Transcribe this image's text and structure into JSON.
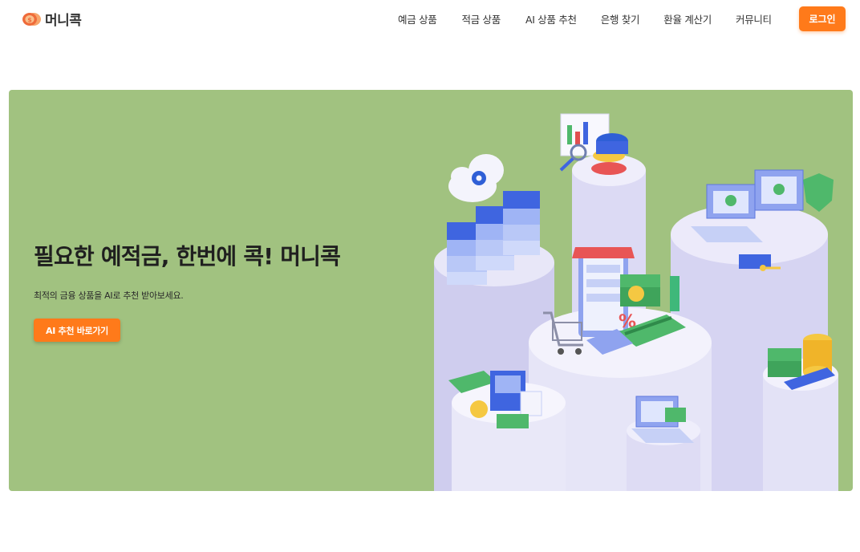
{
  "header": {
    "logo_text": "머니콕",
    "nav": [
      "예금 상품",
      "적금 상품",
      "AI 상품 추천",
      "은행 찾기",
      "환율 계산기",
      "커뮤니티"
    ],
    "login_label": "로그인"
  },
  "hero": {
    "title": "필요한 예적금, 한번에 콕! 머니콕",
    "subtitle": "최적의 금융 상품을 AI로 추천 받아보세요.",
    "cta_label": "AI 추천 바로가기",
    "background_color": "#a1c280",
    "accent_color": "#ff7a1a"
  },
  "icons": [
    "coin-logo-icon"
  ]
}
